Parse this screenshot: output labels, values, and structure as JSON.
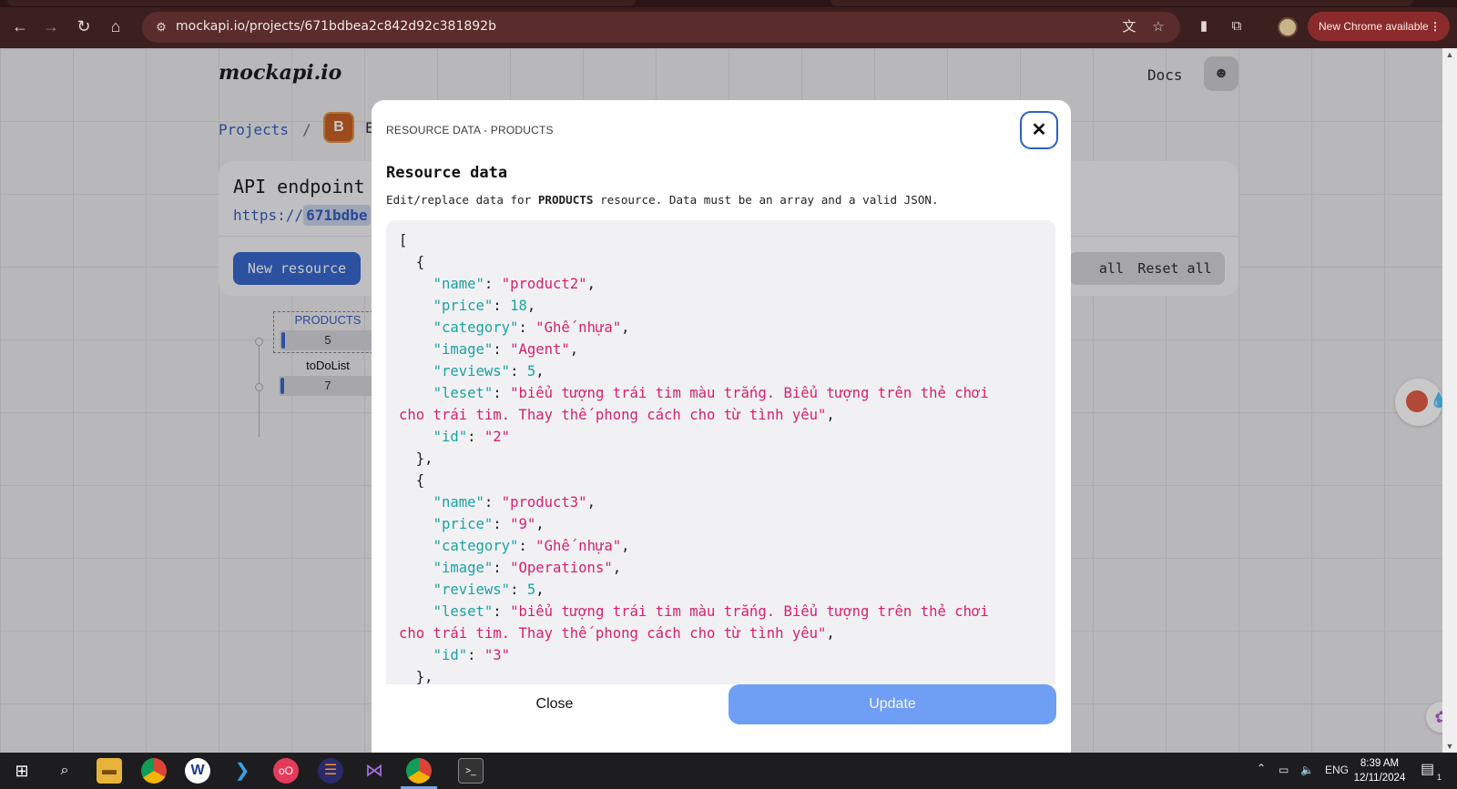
{
  "browser": {
    "url": "mockapi.io/projects/671bdbea2c842d92c381892b",
    "new_chrome_label": "New Chrome available",
    "menu_label": "⋮"
  },
  "site": {
    "logo": "mockapi.io",
    "docs_label": "Docs",
    "breadcrumb_projects": "Projects",
    "breadcrumb_sep": "/",
    "project_badge": "B",
    "project_name_partial": "E",
    "endpoint_title": "API endpoint",
    "endpoint_url_prefix": "https://",
    "endpoint_url_host": "671bdbe",
    "new_resource_label": "New resource",
    "generate_all_partial": "all",
    "reset_all_label": "Reset all",
    "resources": [
      {
        "name": "PRODUCTS",
        "count": "5"
      },
      {
        "name": "toDoList",
        "count": "7"
      }
    ]
  },
  "modal": {
    "header": "RESOURCE DATA - PRODUCTS",
    "title": "Resource data",
    "desc_before": "Edit/replace data for ",
    "desc_resource": "PRODUCTS",
    "desc_after": " resource. Data must be an array and a valid JSON.",
    "close_label": "Close",
    "update_label": "Update",
    "json_lines": [
      [
        {
          "t": "p",
          "v": "["
        }
      ],
      [
        {
          "t": "p",
          "v": "  {"
        }
      ],
      [
        {
          "t": "p",
          "v": "    "
        },
        {
          "t": "k",
          "v": "\"name\""
        },
        {
          "t": "p",
          "v": ": "
        },
        {
          "t": "s",
          "v": "\"product2\""
        },
        {
          "t": "p",
          "v": ","
        }
      ],
      [
        {
          "t": "p",
          "v": "    "
        },
        {
          "t": "k",
          "v": "\"price\""
        },
        {
          "t": "p",
          "v": ": "
        },
        {
          "t": "n",
          "v": "18"
        },
        {
          "t": "p",
          "v": ","
        }
      ],
      [
        {
          "t": "p",
          "v": "    "
        },
        {
          "t": "k",
          "v": "\"category\""
        },
        {
          "t": "p",
          "v": ": "
        },
        {
          "t": "s",
          "v": "\"Ghế nhựa\""
        },
        {
          "t": "p",
          "v": ","
        }
      ],
      [
        {
          "t": "p",
          "v": "    "
        },
        {
          "t": "k",
          "v": "\"image\""
        },
        {
          "t": "p",
          "v": ": "
        },
        {
          "t": "s",
          "v": "\"Agent\""
        },
        {
          "t": "p",
          "v": ","
        }
      ],
      [
        {
          "t": "p",
          "v": "    "
        },
        {
          "t": "k",
          "v": "\"reviews\""
        },
        {
          "t": "p",
          "v": ": "
        },
        {
          "t": "n",
          "v": "5"
        },
        {
          "t": "p",
          "v": ","
        }
      ],
      [
        {
          "t": "p",
          "v": "    "
        },
        {
          "t": "k",
          "v": "\"leset\""
        },
        {
          "t": "p",
          "v": ": "
        },
        {
          "t": "s",
          "v": "\"biểu tượng trái tim màu trắng. Biểu tượng trên thẻ chơi"
        }
      ],
      [
        {
          "t": "s",
          "v": "cho trái tim. Thay thế phong cách cho từ tình yêu\""
        },
        {
          "t": "p",
          "v": ","
        }
      ],
      [
        {
          "t": "p",
          "v": "    "
        },
        {
          "t": "k",
          "v": "\"id\""
        },
        {
          "t": "p",
          "v": ": "
        },
        {
          "t": "s",
          "v": "\"2\""
        }
      ],
      [
        {
          "t": "p",
          "v": "  },"
        }
      ],
      [
        {
          "t": "p",
          "v": "  {"
        }
      ],
      [
        {
          "t": "p",
          "v": "    "
        },
        {
          "t": "k",
          "v": "\"name\""
        },
        {
          "t": "p",
          "v": ": "
        },
        {
          "t": "s",
          "v": "\"product3\""
        },
        {
          "t": "p",
          "v": ","
        }
      ],
      [
        {
          "t": "p",
          "v": "    "
        },
        {
          "t": "k",
          "v": "\"price\""
        },
        {
          "t": "p",
          "v": ": "
        },
        {
          "t": "s",
          "v": "\"9\""
        },
        {
          "t": "p",
          "v": ","
        }
      ],
      [
        {
          "t": "p",
          "v": "    "
        },
        {
          "t": "k",
          "v": "\"category\""
        },
        {
          "t": "p",
          "v": ": "
        },
        {
          "t": "s",
          "v": "\"Ghế nhựa\""
        },
        {
          "t": "p",
          "v": ","
        }
      ],
      [
        {
          "t": "p",
          "v": "    "
        },
        {
          "t": "k",
          "v": "\"image\""
        },
        {
          "t": "p",
          "v": ": "
        },
        {
          "t": "s",
          "v": "\"Operations\""
        },
        {
          "t": "p",
          "v": ","
        }
      ],
      [
        {
          "t": "p",
          "v": "    "
        },
        {
          "t": "k",
          "v": "\"reviews\""
        },
        {
          "t": "p",
          "v": ": "
        },
        {
          "t": "n",
          "v": "5"
        },
        {
          "t": "p",
          "v": ","
        }
      ],
      [
        {
          "t": "p",
          "v": "    "
        },
        {
          "t": "k",
          "v": "\"leset\""
        },
        {
          "t": "p",
          "v": ": "
        },
        {
          "t": "s",
          "v": "\"biểu tượng trái tim màu trắng. Biểu tượng trên thẻ chơi"
        }
      ],
      [
        {
          "t": "s",
          "v": "cho trái tim. Thay thế phong cách cho từ tình yêu\""
        },
        {
          "t": "p",
          "v": ","
        }
      ],
      [
        {
          "t": "p",
          "v": "    "
        },
        {
          "t": "k",
          "v": "\"id\""
        },
        {
          "t": "p",
          "v": ": "
        },
        {
          "t": "s",
          "v": "\"3\""
        }
      ],
      [
        {
          "t": "p",
          "v": "  },"
        }
      ]
    ]
  },
  "taskbar": {
    "apps": [
      "windows-start",
      "search",
      "file-explorer",
      "chrome",
      "wordpad",
      "vscode",
      "app-oo",
      "eclipse",
      "visual-studio",
      "chrome-active",
      "terminal"
    ],
    "lang": "ENG",
    "time": "8:39 AM",
    "date": "12/11/2024",
    "notif_count": "1"
  },
  "colors": {
    "accent": "#2d5fc7",
    "update_button": "#6f9ff5",
    "json_key": "#1aa3a3",
    "json_string": "#d8206e",
    "chrome_bg": "#3c1f1f"
  }
}
